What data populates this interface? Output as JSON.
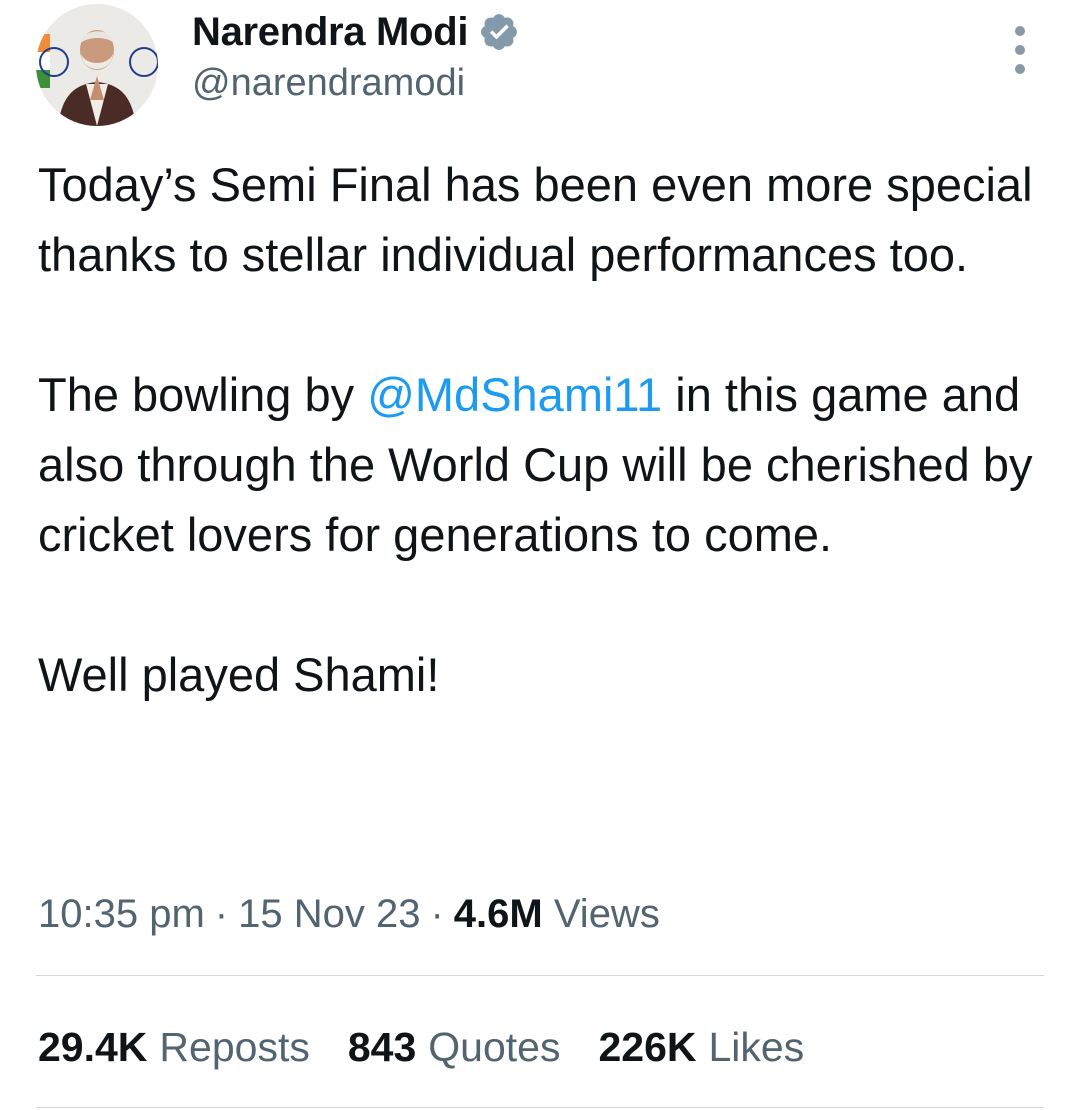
{
  "author": {
    "display_name": "Narendra Modi",
    "handle": "@narendramodi",
    "verified": true,
    "avatar_icon": "profile-photo-namaste"
  },
  "tweet": {
    "paragraph_1": "Today’s Semi Final has been even more special thanks to stellar individual performances too.",
    "paragraph_2_before": "The bowling by ",
    "paragraph_2_mention": "@MdShami11",
    "paragraph_2_after": " in this game and also through the World Cup will be cherished by cricket lovers for generations to come.",
    "paragraph_3": "Well played Shami!"
  },
  "meta": {
    "time": "10:35 pm",
    "separator": "·",
    "date": "15 Nov 23",
    "views_count": "4.6M",
    "views_label": "Views"
  },
  "stats": {
    "reposts_count": "29.4K",
    "reposts_label": "Reposts",
    "quotes_count": "843",
    "quotes_label": "Quotes",
    "likes_count": "226K",
    "likes_label": "Likes"
  },
  "colors": {
    "text": "#0f1419",
    "secondary": "#536471",
    "link": "#1d9bf0",
    "verified_badge": "#829aab",
    "divider": "#cfd9de"
  },
  "icons": {
    "verified": "verified-badge-icon",
    "more": "more-vertical-icon"
  }
}
